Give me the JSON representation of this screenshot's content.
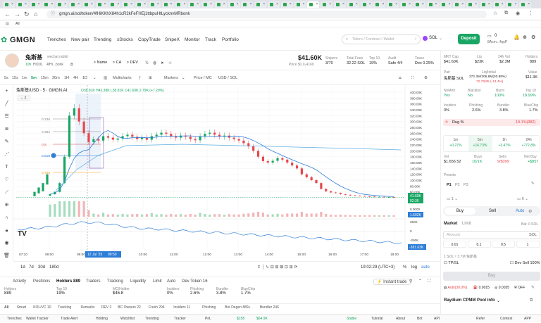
{
  "browser": {
    "url": "gmgn.ai/sol/token/4fHiKKhX84h1cR2kFeFHEj1ttbpuHtLycknvMRbonk",
    "bookmark_all": "All",
    "tab_count": 40
  },
  "header": {
    "logo": "GMGN",
    "nav": [
      "Trenches",
      "New pair",
      "Trending",
      "xStocks",
      "CopyTrade",
      "SnipeX",
      "Monitor",
      "Track",
      "Portfolio"
    ],
    "search_placeholder": "Token / Contract / Wallet",
    "search_shortcut": "/",
    "chain": "SOL",
    "deposit": "Deposit",
    "wallet_balance": "0",
    "wallet_addr": "8Acm...4qcP"
  },
  "token": {
    "name": "兔斯基",
    "wechat": "wechat rabbit",
    "age": "10h",
    "hodl": "HODL",
    "addr": "4fHi...bonk",
    "links": [
      "Name",
      "CA",
      "DEV"
    ],
    "price": "$41.60K",
    "price_sub": "Price $0.0₄4160",
    "snipers_label": "Snipers",
    "snipers": "3/70",
    "fees_label": "Total Fees",
    "fees": "32.22 SOL",
    "top10_label": "Top 10",
    "top10": "19%",
    "audit_label": "Audit",
    "audit": "Safe 4/4",
    "taxes_label": "Taxes",
    "taxes": "Dex 0.25%"
  },
  "chart_toolbar": {
    "intervals": [
      "5s",
      "15s",
      "1m",
      "5m",
      "15m",
      "30m",
      "1H",
      "4H",
      "1D"
    ],
    "multicharts": "Multicharts",
    "markers": "Markers",
    "price_mc": "Price / MC",
    "usd_sol": "USD / SOL"
  },
  "chart": {
    "legend": "兔斯基/USD · 5 · GMGN.AI",
    "ohlc": "O38.81K H42.38K L38.81K C41.60K 2.79K (+7.20%)",
    "fib_labels": [
      "0.236",
      "0.382",
      "0.5",
      "0.618",
      "0.786"
    ],
    "current_price_tag": "41.60K",
    "current_time_tag": "02:30",
    "volume_tag": "1.602K",
    "osc_tag": "-381.63K",
    "x_highlight": "12 Jul '25",
    "x_time_highlight": "09:50",
    "time_display": "19:02:29 (UTC+3)",
    "ranges": [
      "1d",
      "7d",
      "30d",
      "180d"
    ],
    "scale_toggles": [
      "%",
      "log",
      "auto"
    ]
  },
  "chart_data": {
    "type": "candlestick",
    "title": "兔斯基/USD · 5 · GMGN.AI",
    "xlabel": "",
    "ylabel": "",
    "x_ticks": [
      "07:10",
      "08:00",
      "09:00",
      "10:00",
      "11:00",
      "12:00",
      "13:00",
      "14:00",
      "15:00",
      "16:00",
      "17:00",
      "18:00",
      "19:00"
    ],
    "y_ticks": [
      "400.00K",
      "380.00K",
      "360.00K",
      "340.00K",
      "320.00K",
      "300.00K",
      "280.00K",
      "260.00K",
      "240.00K",
      "220.00K",
      "200.00K",
      "180.00K",
      "160.00K",
      "140.00K",
      "120.00K",
      "100.00K",
      "80.00K",
      "60.00K",
      "40.00K"
    ],
    "ylim": [
      40000,
      400000
    ],
    "vol_ticks": [
      "0.0000"
    ],
    "osc_ticks": [
      "250K",
      "0",
      "-250K"
    ],
    "close_series": [
      52000,
      60000,
      90000,
      180000,
      320000,
      345000,
      300000,
      260000,
      230000,
      240000,
      235000,
      250000,
      245000,
      238000,
      242000,
      250000,
      255000,
      248000,
      240000,
      245000,
      238000,
      250000,
      255000,
      262000,
      258000,
      250000,
      245000,
      252000,
      248000,
      240000,
      236000,
      250000,
      258000,
      262000,
      255000,
      248000,
      252000,
      245000,
      240000,
      235000,
      226000,
      215000,
      200000,
      180000,
      165000,
      160000,
      166000,
      175000,
      170000,
      160000,
      150000,
      140000,
      120000,
      110000,
      100000,
      90000,
      70000,
      62000,
      58000,
      56000,
      52000,
      50000,
      48000,
      47000,
      46000,
      45000,
      44000,
      43000,
      43000,
      42000,
      42000,
      41600
    ]
  },
  "bottom_tabs": [
    "Activity",
    "Positions",
    "Holders 889",
    "Traders",
    "Tracking",
    "Liquidity",
    "Limit",
    "Auto",
    "Dev Token 16"
  ],
  "instant_trade": "Instant trade",
  "holder_stats": [
    {
      "label": "Holders",
      "value": "889"
    },
    {
      "label": "Top 10",
      "value": "19%"
    },
    {
      "label": "MC/Holder",
      "value": "$46.8"
    },
    {
      "label": "Insiders",
      "value": "0%"
    },
    {
      "label": "Phishing",
      "value": "2.6%"
    },
    {
      "label": "Bundler",
      "value": "3.8%"
    },
    {
      "label": "BlueChip",
      "value": "1.7%"
    }
  ],
  "filters": [
    "All",
    "Smart",
    "KOL/VC 10",
    "Tracking",
    "Remarks",
    "DEV 2",
    "BC Owners 22",
    "Fresh 294",
    "Insiders 11",
    "Phishing",
    "Bot Degen 889+",
    "Bundler 246"
  ],
  "status_bar": [
    "Trenches",
    "Wallet Tracker",
    "Trade Alert",
    "Holding",
    "Watchlist",
    "Trending",
    "Tracker",
    "PnL",
    "$158",
    "$64.9K",
    "Stable",
    "Tutorial",
    "About",
    "Bot",
    "API",
    "Refer",
    "Contest",
    "APP"
  ],
  "right": {
    "mktcap_label": "MKT Cap",
    "mktcap": "$41.60K",
    "liq_label": "Liq",
    "liq": "$23K",
    "vol24_label": "24h Vol",
    "vol24": "$2.3M",
    "holders_label": "Holders",
    "holders": "889",
    "pair_label": "Pair",
    "pair": "兔斯基 SOL",
    "liqinit_label": "Liq/Initial",
    "liqinit": "272.3M/206.8M(30.89%)",
    "liqsol": "72.79/85 (-14.4%)",
    "value_label": "Value",
    "value": "$11.3K",
    "nomint_label": "NoMint",
    "nomint": "Yes",
    "blacklist_label": "Blacklist",
    "blacklist": "No",
    "burnt_label": "Burnt",
    "burnt": "100%",
    "top10_label": "Top 10",
    "top10": "18.99%",
    "insiders_label": "Insiders",
    "insiders": "0%",
    "phishing_label": "Phishing",
    "phishing": "2.6%",
    "bundler_label": "Bundler",
    "bundler": "3.8%",
    "bluechip_label": "BlueChip",
    "bluechip": "1.7%",
    "rug_label": "Rug %",
    "rug": "19.1%(382)",
    "timeframes": [
      {
        "label": "1m",
        "pct": "+0.27%"
      },
      {
        "label": "5m",
        "pct": "+16.73%"
      },
      {
        "label": "1h",
        "pct": "+3.47%"
      },
      {
        "label": "24h",
        "pct": "+772.8%"
      }
    ],
    "vol_label": "Vol",
    "vol": "$1.656.52",
    "buys_label": "Buys",
    "buys": "10/1K",
    "sells_label": "Sells",
    "sells": "9/$399",
    "netbuy_label": "Net Buy",
    "netbuy": "+$857",
    "presets_label": "Presets",
    "presets": [
      "P1",
      "P2",
      "P3"
    ],
    "buy": "Buy",
    "sell": "Sell",
    "auto": "Auto",
    "market": "Market",
    "limit": "Limit",
    "balance": "Bal: 0 SOL",
    "amount_placeholder": "Amount",
    "amount_unit": "SOL",
    "quick_amounts": [
      "0.01",
      "0.1",
      "0.5",
      "1"
    ],
    "conversion": "1 SOL ≈ 3.7M 兔斯基",
    "tpsl": "TP/SL",
    "devsell": "Dev Sell 100%",
    "buy_button": "Buy",
    "auto_pct": "Auto(30.0%)",
    "fee1": "0.0015",
    "fee2": "0.0035",
    "off": "OFF",
    "pool_info": "Raydium CPMM Pool info"
  }
}
